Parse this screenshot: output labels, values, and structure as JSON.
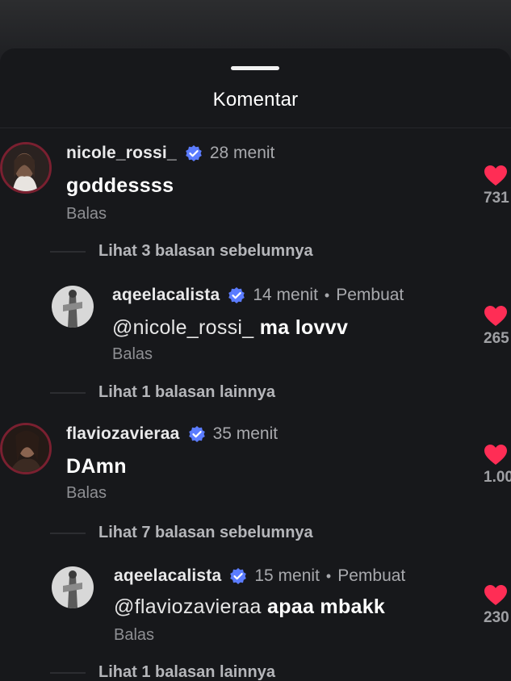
{
  "header": {
    "title": "Komentar"
  },
  "comments": [
    {
      "username": "nicole_rossi_",
      "time": "28 menit",
      "text": "goddessss",
      "reply_label": "Balas",
      "likes": "731",
      "avatar_color": "#6b4a3a"
    },
    {
      "username": "flaviozavieraa",
      "time": "35 menit",
      "text": "DAmn",
      "reply_label": "Balas",
      "likes": "1.00",
      "avatar_color": "#4a3328"
    }
  ],
  "thread_links": [
    "Lihat 3 balasan sebelumnya",
    "Lihat 1 balasan lainnya",
    "Lihat 7 balasan sebelumnya",
    "Lihat 1 balasan lainnya"
  ],
  "replies": [
    {
      "username": "aqeelacalista",
      "time": "14 menit",
      "dot": "•",
      "creator_label": "Pembuat",
      "mention": "@nicole_rossi_",
      "text": " ma lovvv",
      "reply_label": "Balas",
      "likes": "265"
    },
    {
      "username": "aqeelacalista",
      "time": "15 menit",
      "dot": "•",
      "creator_label": "Pembuat",
      "mention": "@flaviozavieraa",
      "text": " apaa mbakk",
      "reply_label": "Balas",
      "likes": "230"
    }
  ],
  "colors": {
    "heart": "#ff2d55",
    "verified": "#5b7cff",
    "background": "#17181b"
  }
}
